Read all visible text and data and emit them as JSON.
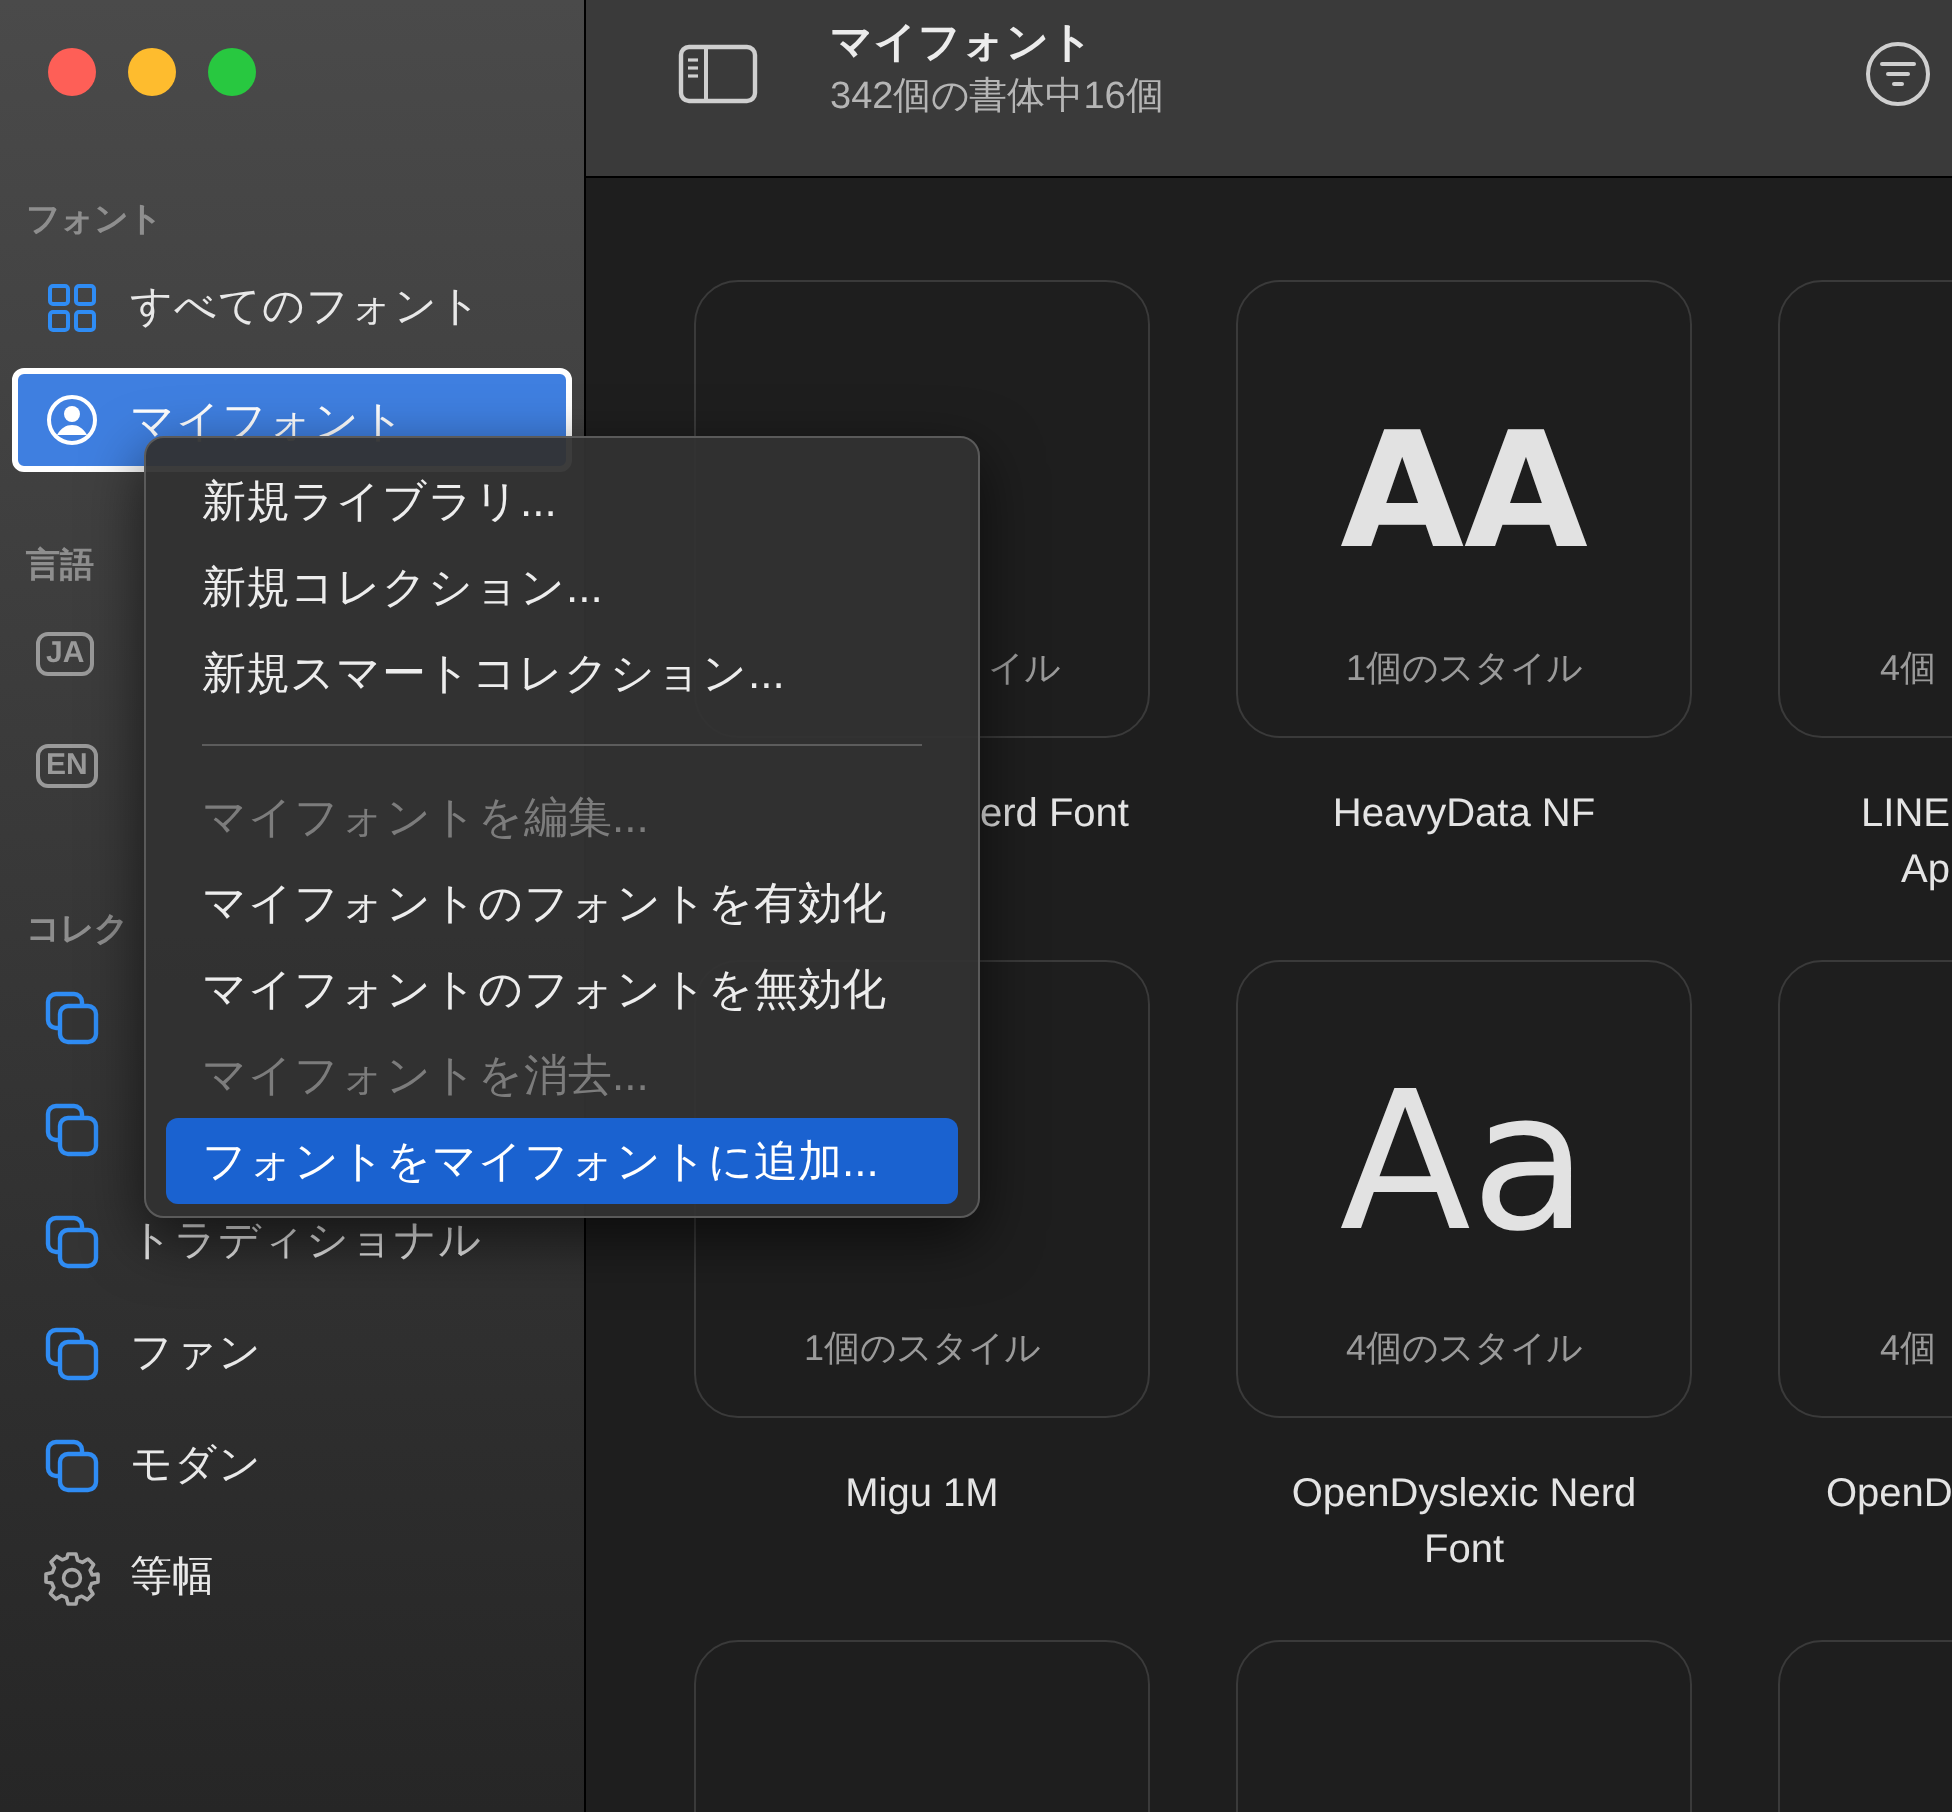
{
  "window": {
    "title": "マイフォント",
    "subtitle": "342個の書体中16個"
  },
  "sidebar": {
    "sections": [
      {
        "heading": "フォント",
        "items": [
          {
            "kind": "grid",
            "label": "すべてのフォント",
            "selected": false
          },
          {
            "kind": "person",
            "label": "マイフォント",
            "selected": true
          }
        ]
      },
      {
        "heading": "言語",
        "items": [
          {
            "kind": "badge",
            "badge": "JA",
            "selected": false
          },
          {
            "kind": "badge",
            "badge": "EN",
            "selected": false
          }
        ]
      },
      {
        "heading": "コレク",
        "items": [
          {
            "kind": "collection",
            "selected": false
          },
          {
            "kind": "collection",
            "selected": false
          },
          {
            "kind": "collection",
            "label": "トラディショナル",
            "selected": false
          },
          {
            "kind": "collection",
            "label": "ファン",
            "selected": false
          },
          {
            "kind": "collection",
            "label": "モダン",
            "selected": false
          },
          {
            "kind": "smart",
            "label": "等幅",
            "selected": false
          }
        ]
      }
    ]
  },
  "context_menu": {
    "items": [
      {
        "kind": "item",
        "label": "新規ライブラリ...",
        "disabled": false,
        "selected": false
      },
      {
        "kind": "item",
        "label": "新規コレクション...",
        "disabled": false,
        "selected": false
      },
      {
        "kind": "item",
        "label": "新規スマートコレクション...",
        "disabled": false,
        "selected": false
      },
      {
        "kind": "separator"
      },
      {
        "kind": "item",
        "label": "マイフォントを編集...",
        "disabled": true,
        "selected": false
      },
      {
        "kind": "item",
        "label": "マイフォントのフォントを有効化",
        "disabled": false,
        "selected": false
      },
      {
        "kind": "item",
        "label": "マイフォントのフォントを無効化",
        "disabled": false,
        "selected": false
      },
      {
        "kind": "item",
        "label": "マイフォントを消去...",
        "disabled": true,
        "selected": false
      },
      {
        "kind": "item",
        "label": "フォントをマイフォントに追加...",
        "disabled": false,
        "selected": true
      }
    ]
  },
  "fonts": [
    {
      "kind": "card",
      "styles": "イル",
      "name": "erd Font"
    },
    {
      "kind": "card",
      "preview": "AA",
      "styles": "1個のスタイル",
      "name": "HeavyData NF"
    },
    {
      "kind": "card",
      "styles": "4個",
      "name": "LINE Ap"
    },
    {
      "kind": "card",
      "styles": "1個のスタイル",
      "name": "Migu 1M"
    },
    {
      "kind": "card",
      "preview": "Aa",
      "styles": "4個のスタイル",
      "name": "OpenDyslexic Nerd Font"
    },
    {
      "kind": "card",
      "styles": "4個",
      "name": "OpenD"
    },
    {
      "kind": "card"
    },
    {
      "kind": "card"
    },
    {
      "kind": "card"
    }
  ]
}
